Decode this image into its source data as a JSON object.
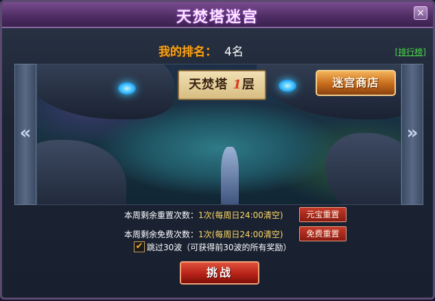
{
  "window": {
    "title": "天焚塔迷宫",
    "close_icon": "close-icon"
  },
  "rank": {
    "label": "我的排名：",
    "value": "4名",
    "leaderboard_link": "[排行榜]"
  },
  "scene": {
    "level_prefix": "天焚塔",
    "level_number": "1",
    "level_suffix": "层",
    "shop_button": "迷宫商店",
    "prev_arrow": "«",
    "next_arrow": "»"
  },
  "reset": {
    "paid_label": "本周剩余重置次数：",
    "paid_value": "1次(每周日24:00清空)",
    "paid_button": "元宝重置",
    "free_label": "本周剩余免费次数：",
    "free_value": "1次(每周日24:00清空)",
    "free_button": "免费重置",
    "skip_checked": true,
    "skip_check_mark": "✔",
    "skip_label": "跳过30波（可获得前30波的所有奖励）"
  },
  "actions": {
    "challenge_button": "挑战"
  },
  "colors": {
    "rank_label": "#f3a41c",
    "leaderboard_link": "#4dd84d",
    "info_value": "#ffd866"
  }
}
